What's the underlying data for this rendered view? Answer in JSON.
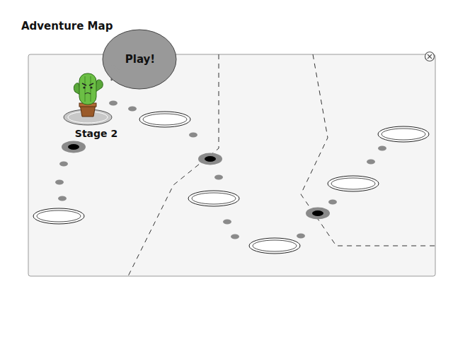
{
  "title": "Adventure Map",
  "bubble": {
    "text": "Play!"
  },
  "stages": [
    {
      "kind": "open",
      "selected": false
    },
    {
      "kind": "locked",
      "selected": false
    },
    {
      "kind": "current",
      "selected": true,
      "label": "Stage 2"
    },
    {
      "kind": "open",
      "selected": false
    },
    {
      "kind": "locked",
      "selected": false
    },
    {
      "kind": "open",
      "selected": false
    },
    {
      "kind": "open",
      "selected": false
    },
    {
      "kind": "locked",
      "selected": false
    },
    {
      "kind": "open",
      "selected": false
    },
    {
      "kind": "open",
      "selected": false
    }
  ]
}
